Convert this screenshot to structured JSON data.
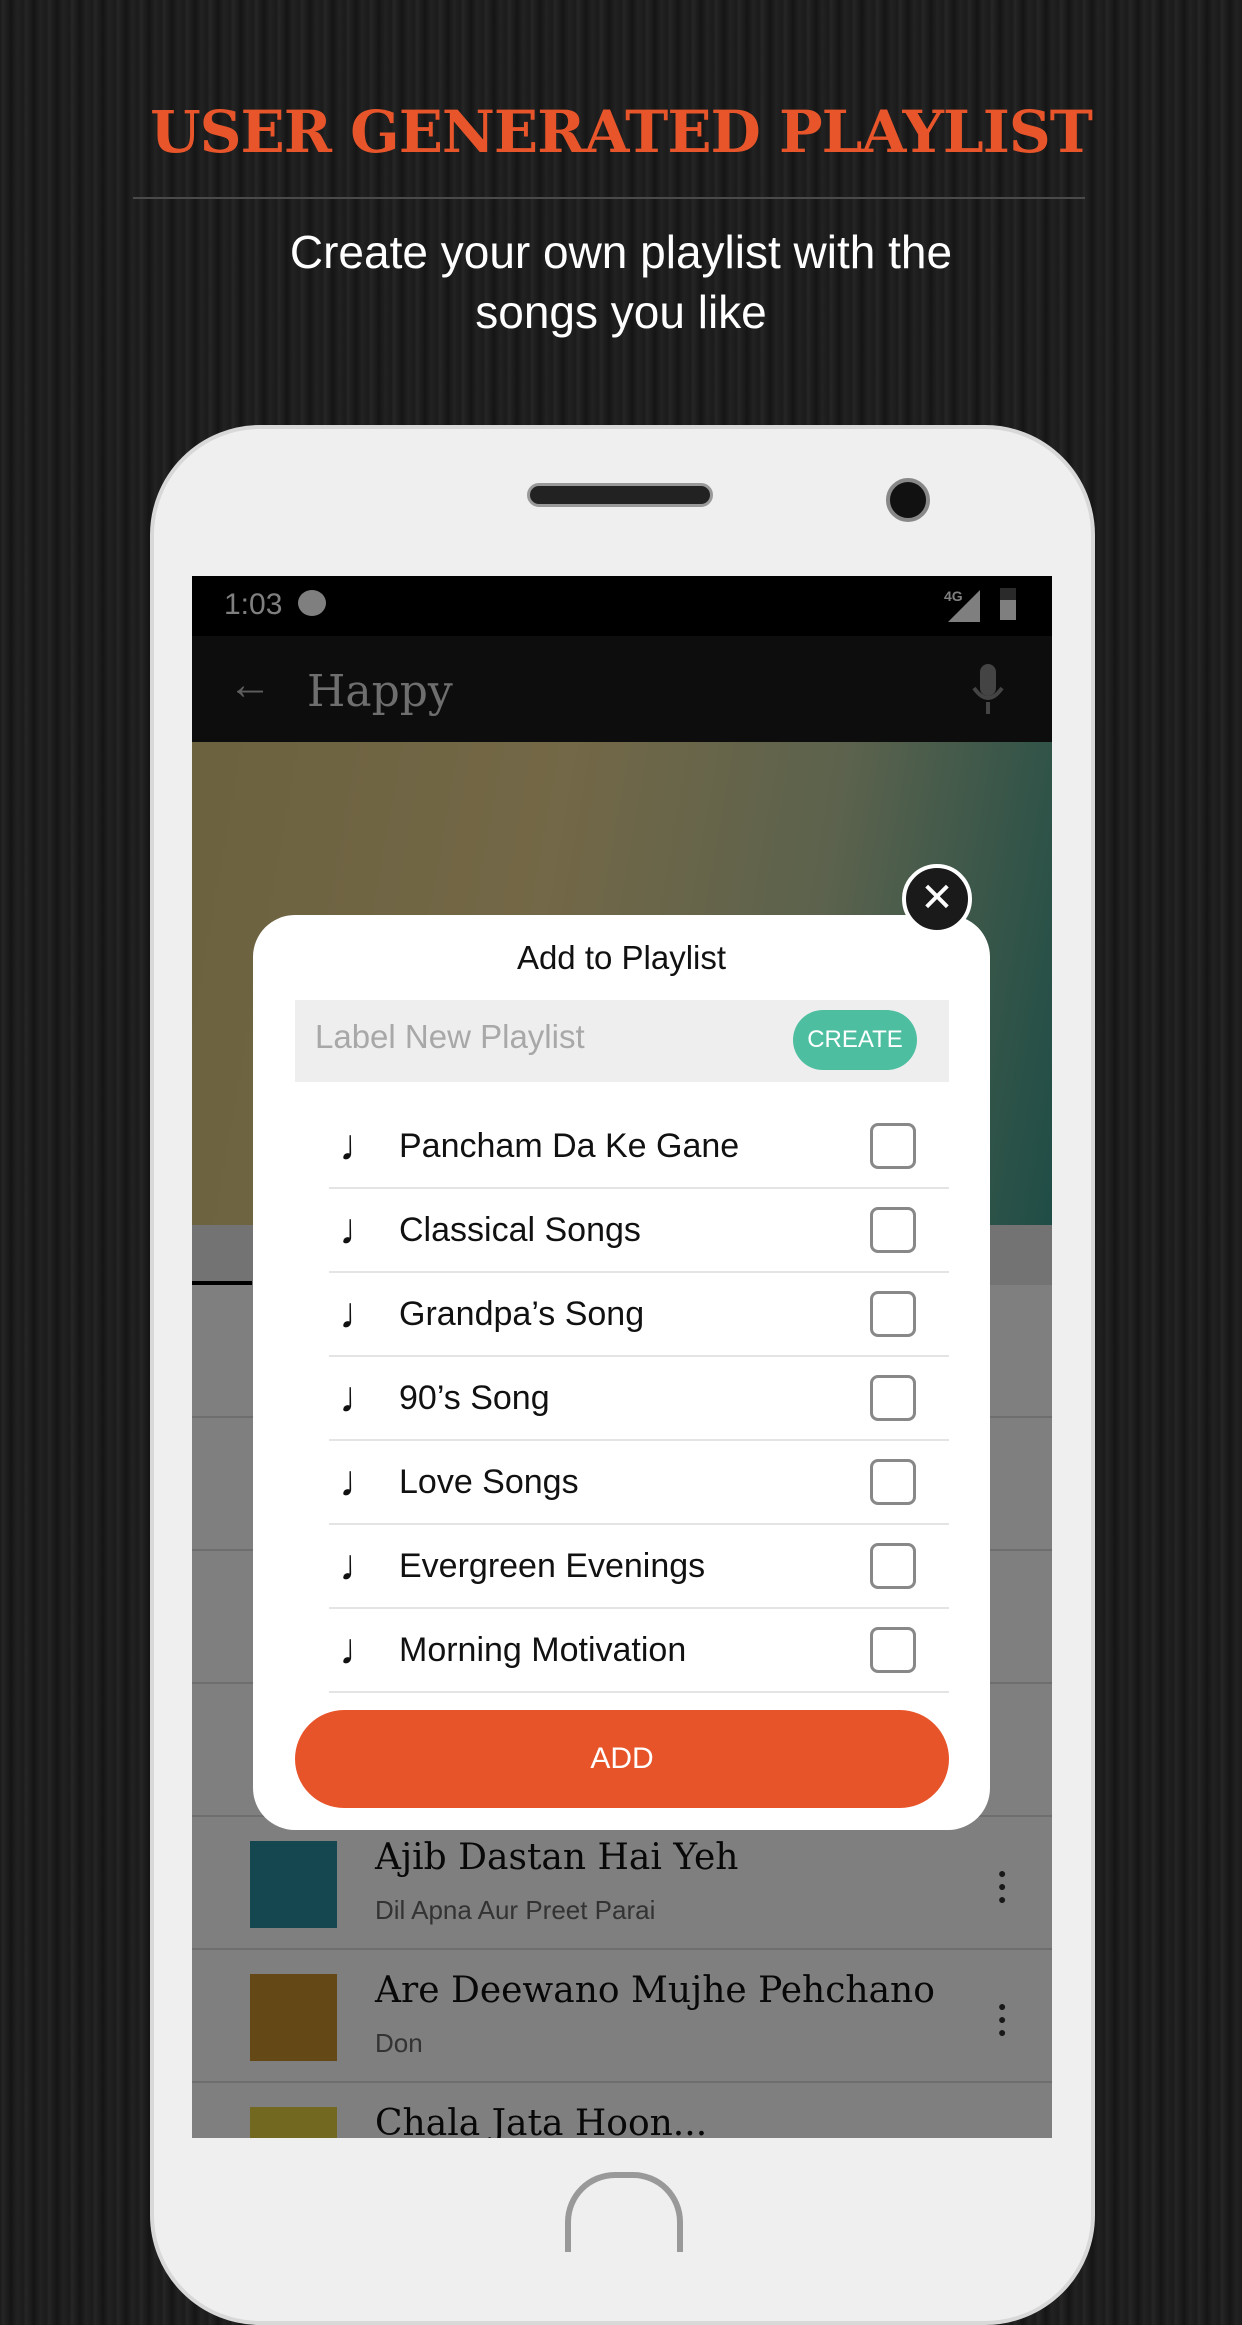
{
  "banner": {
    "title": "USER GENERATED PLAYLIST",
    "subtitle_line1": "Create your own playlist with the",
    "subtitle_line2": "songs you like"
  },
  "status_bar": {
    "time": "1:03",
    "network": "4G",
    "icons": [
      "message-icon",
      "signal-icon",
      "battery-icon"
    ]
  },
  "toolbar": {
    "search_value": "Happy",
    "icons": [
      "back-arrow-icon",
      "microphone-icon"
    ]
  },
  "songs": [
    {
      "title": "Ajib Dastan Hai Yeh",
      "album": "Dil Apna Aur Preet Parai"
    },
    {
      "title": "Are Deewano Mujhe Pehchano",
      "album": "Don"
    },
    {
      "title": "Chala Jata Hoon...",
      "album": ""
    }
  ],
  "dialog": {
    "title": "Add to Playlist",
    "new_playlist_placeholder": "Label New Playlist",
    "create_label": "CREATE",
    "add_label": "ADD",
    "playlists": [
      {
        "name": "Pancham Da Ke Gane",
        "checked": false
      },
      {
        "name": "Classical Songs",
        "checked": false
      },
      {
        "name": "Grandpa’s Song",
        "checked": false
      },
      {
        "name": "90’s Song",
        "checked": false
      },
      {
        "name": "Love Songs",
        "checked": false
      },
      {
        "name": "Evergreen Evenings",
        "checked": false
      },
      {
        "name": "Morning Motivation",
        "checked": false
      }
    ]
  },
  "colors": {
    "accent": "#e8542a",
    "create": "#4dbfa0"
  }
}
